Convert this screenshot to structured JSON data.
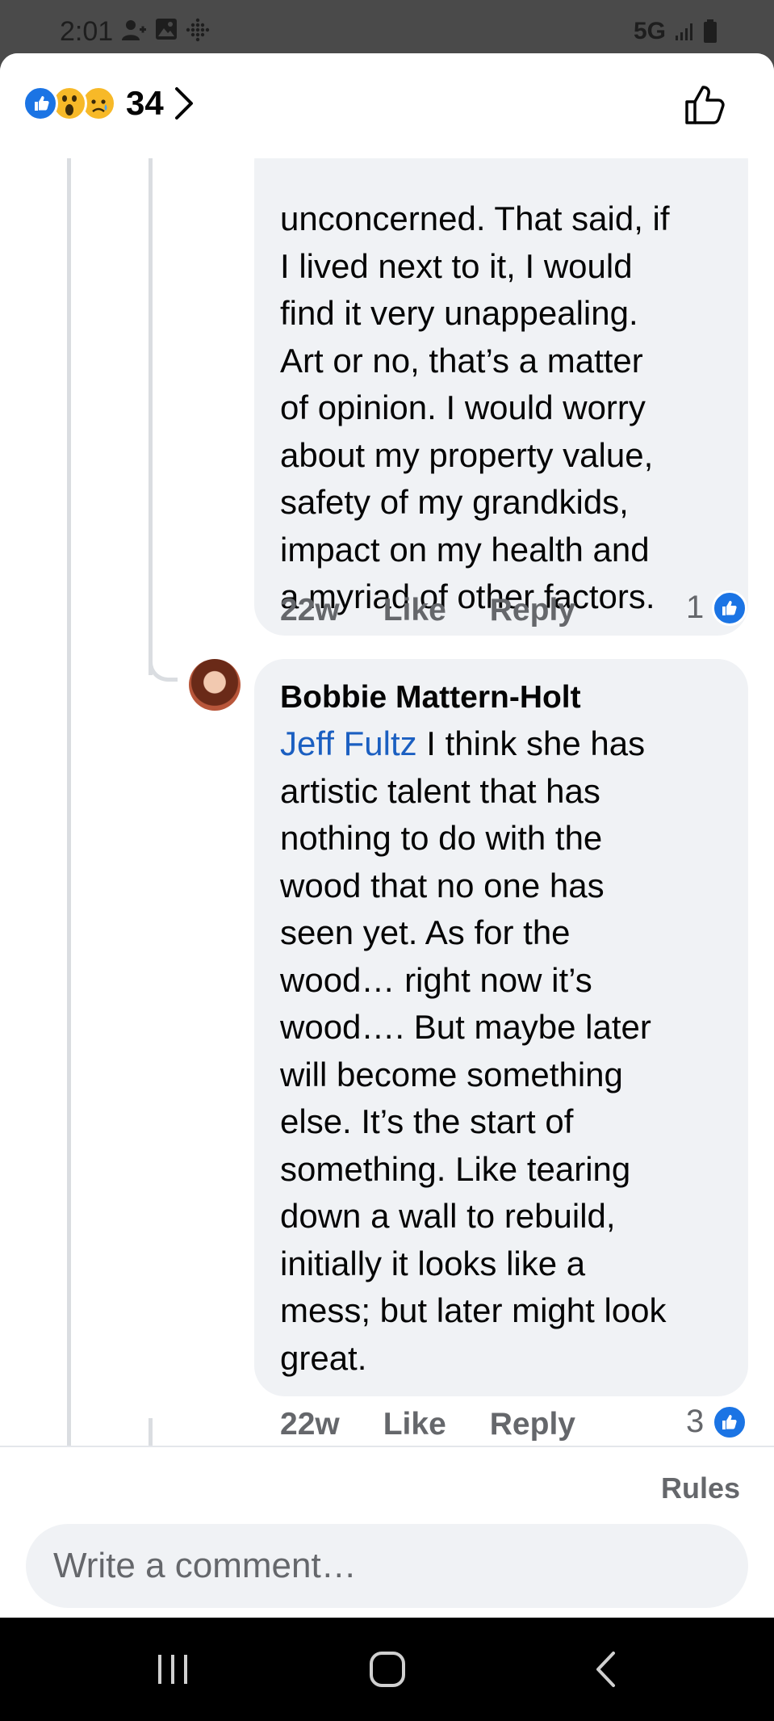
{
  "status_bar": {
    "time": "2:01",
    "network": "5G"
  },
  "header": {
    "reaction_count": "34",
    "reactions": [
      "like-icon",
      "wow-icon",
      "sad-icon"
    ]
  },
  "comments": [
    {
      "lines": [
        "unconcerned.  That said, if",
        "I lived next to it, I would",
        "find it very unappealing.",
        "Art or no, that’s a matter",
        "of opinion. I would worry",
        "about my property value,",
        "safety of my grandkids,",
        "impact on my health and",
        "a myriad of other factors."
      ],
      "age": "22w",
      "like_label": "Like",
      "reply_label": "Reply",
      "like_count": "1"
    },
    {
      "author": "Bobbie Mattern-Holt",
      "mention": "Jeff Fultz",
      "first_line_rest": " I think she has",
      "lines": [
        "artistic talent that has",
        "nothing to do with the",
        "wood that no one has",
        "seen yet.  As for the",
        "wood… right now it’s",
        "wood…. But maybe later",
        "will become something",
        "else.  It’s the start of",
        "something.  Like tearing",
        "down a wall to rebuild,",
        "initially it looks like a",
        "mess; but later might look",
        "great."
      ],
      "age": "22w",
      "like_label": "Like",
      "reply_label": "Reply",
      "like_count": "3"
    }
  ],
  "composer": {
    "rules_label": "Rules",
    "placeholder": "Write a comment…"
  },
  "colors": {
    "facebook_blue": "#1b74e4",
    "mention_blue": "#1b5fc1",
    "bubble_bg": "#f0f2f5",
    "meta_gray": "#65676b"
  }
}
